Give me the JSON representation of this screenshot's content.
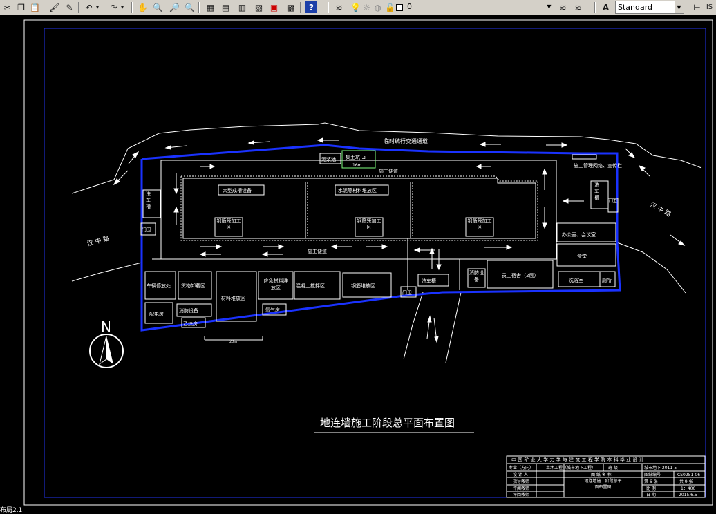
{
  "toolbar": {
    "layer_value": "0",
    "text_style": "Standard",
    "right_label": "IS"
  },
  "drawing": {
    "title": "地连墙施工阶段总平面布置图",
    "north": "N",
    "road_top": "临时统行交通通道",
    "road_left": "汉 中 路",
    "road_right": "汉 中 路",
    "labels": {
      "mud_pool": "泥浆池",
      "slurry_box": "集土坑 ⊿",
      "slurry_dim": "16m",
      "road_inner_top": "施工便道",
      "road_inner_bottom": "施工便道",
      "mgmt": "施工管理网络、宣传栏",
      "big_tools": "大型成槽设备",
      "cement": "水泥等材料堆放区",
      "rebar1": "钢筋笼加工区",
      "rebar2": "钢筋笼加工区",
      "rebar3": "钢筋笼加工区",
      "wash_left": "洗车槽",
      "wash_right": "洗车槽",
      "wash_bottom": "洗车槽",
      "gate_left": "门卫",
      "gate_right": "门卫",
      "gate_bottom": "门卫",
      "office": "办公室、会议室",
      "canteen": "食堂",
      "bath": "洗浴室",
      "toilet": "厕所",
      "dorm": "员工宿舍（2层）",
      "fire_right": "消防设备",
      "vehicle": "车辆停放处",
      "goods": "货物卸载区",
      "material": "材料堆放区",
      "emergency": "应急材料堆放区",
      "concrete": "混凝土搅拌区",
      "rebar_store": "钢筋堆放区",
      "power": "配电房",
      "fire_left": "消防设备",
      "acetylene": "乙炔房",
      "oxygen": "氧气房",
      "scale": "20m"
    },
    "title_block": {
      "header": "中 国 矿 业 大 学 力 学 与 建 筑 工 程 学 院 本 科 毕 业 设 计",
      "r1c1": "专业（方向）",
      "r1c2": "土木工程（城市地下工程）",
      "r1c3": "班 级",
      "r1c4": "城市地下 2011-5",
      "r2c1": "设 计 人",
      "r2c3": "图 纸 名 称",
      "r2c4": "图纸编号",
      "r2c5": "CS0251-06",
      "r3c1": "指导教师",
      "r3c3": "地连墙施工阶段总平面布置图",
      "r3c4": "第 6 张",
      "r3c5": "共 9 张",
      "r4c1": "评阅教师",
      "r4c4": "比 例",
      "r4c5": "1：400",
      "r5c1": "评阅教师",
      "r5c4": "日 期",
      "r5c5": "2015.6.5"
    }
  },
  "status": {
    "layout_label": "布局2.1"
  }
}
